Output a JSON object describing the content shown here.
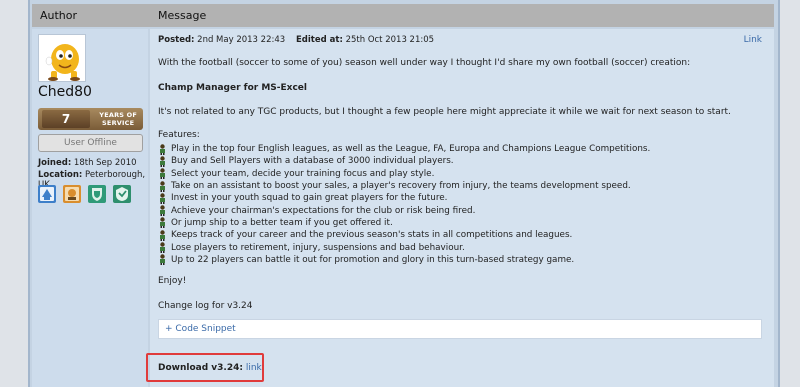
{
  "header": {
    "author_label": "Author",
    "message_label": "Message"
  },
  "author": {
    "username": "Ched80",
    "years_number": "7",
    "years_line1": "YEARS OF",
    "years_line2": "SERVICE",
    "status": "User Offline",
    "joined_label": "Joined:",
    "joined_value": "18th Sep 2010",
    "location_label": "Location:",
    "location_value": "Peterborough, UK",
    "badge_icons": [
      "award-badge-blue-icon",
      "award-badge-orange-icon",
      "award-badge-green-shield-icon",
      "award-badge-green-icon"
    ]
  },
  "post": {
    "posted_label": "Posted:",
    "posted_value": "2nd May 2013 22:43",
    "edited_label": "Edited at:",
    "edited_value": "25th Oct 2013 21:05",
    "link_label": "Link",
    "intro": "With the football (soccer to some of you) season well under way I thought I'd share my own football (soccer) creation:",
    "title": "Champ Manager for MS-Excel",
    "disclaimer": "It's not related to any TGC products, but I thought a few people here might appreciate it while we wait for next season to start.",
    "features_heading": "Features:",
    "features": [
      "Play in the top four English leagues, as well as the League, FA, Europa and Champions League Competitions.",
      "Buy and Sell Players with a database of 3000 individual players.",
      "Select your team, decide your training focus and play style.",
      "Take on an assistant to boost your sales, a player's recovery from injury, the teams development speed.",
      "Invest in your youth squad to gain great players for the future.",
      "Achieve your chairman's expectations for the club or risk being fired.",
      "Or jump ship to a better team if you get offered it.",
      "Keeps track of your career and the previous season's stats in all competitions and leagues.",
      "Lose players to retirement, injury, suspensions and bad behaviour.",
      "Up to 22 players can battle it out for promotion and glory in this turn-based strategy game."
    ],
    "enjoy": "Enjoy!",
    "changelog": "Change log for v3.24",
    "snippet_label": "+ Code Snippet",
    "download_label": "Download v3.24:",
    "download_link": "link"
  }
}
